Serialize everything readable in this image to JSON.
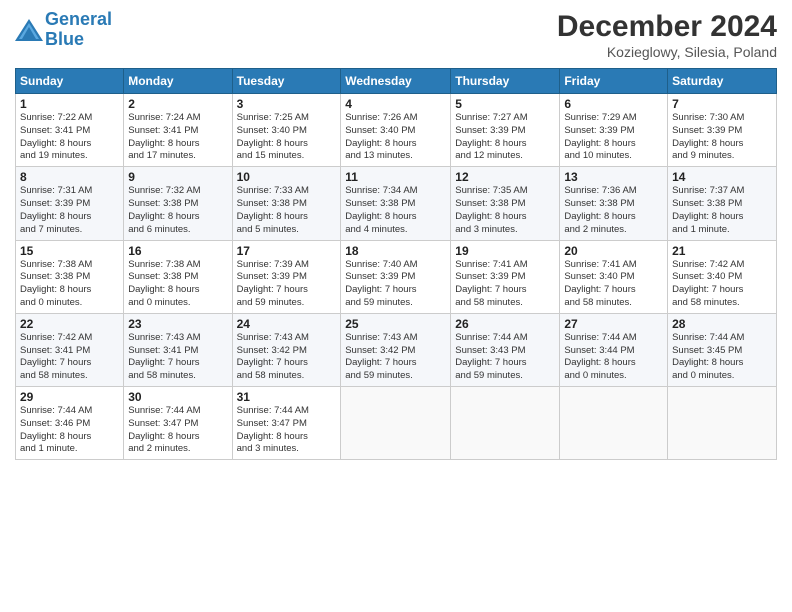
{
  "logo": {
    "line1": "General",
    "line2": "Blue"
  },
  "title": "December 2024",
  "subtitle": "Kozieglowy, Silesia, Poland",
  "days_header": [
    "Sunday",
    "Monday",
    "Tuesday",
    "Wednesday",
    "Thursday",
    "Friday",
    "Saturday"
  ],
  "weeks": [
    [
      {
        "day": "1",
        "info": "Sunrise: 7:22 AM\nSunset: 3:41 PM\nDaylight: 8 hours\nand 19 minutes."
      },
      {
        "day": "2",
        "info": "Sunrise: 7:24 AM\nSunset: 3:41 PM\nDaylight: 8 hours\nand 17 minutes."
      },
      {
        "day": "3",
        "info": "Sunrise: 7:25 AM\nSunset: 3:40 PM\nDaylight: 8 hours\nand 15 minutes."
      },
      {
        "day": "4",
        "info": "Sunrise: 7:26 AM\nSunset: 3:40 PM\nDaylight: 8 hours\nand 13 minutes."
      },
      {
        "day": "5",
        "info": "Sunrise: 7:27 AM\nSunset: 3:39 PM\nDaylight: 8 hours\nand 12 minutes."
      },
      {
        "day": "6",
        "info": "Sunrise: 7:29 AM\nSunset: 3:39 PM\nDaylight: 8 hours\nand 10 minutes."
      },
      {
        "day": "7",
        "info": "Sunrise: 7:30 AM\nSunset: 3:39 PM\nDaylight: 8 hours\nand 9 minutes."
      }
    ],
    [
      {
        "day": "8",
        "info": "Sunrise: 7:31 AM\nSunset: 3:39 PM\nDaylight: 8 hours\nand 7 minutes."
      },
      {
        "day": "9",
        "info": "Sunrise: 7:32 AM\nSunset: 3:38 PM\nDaylight: 8 hours\nand 6 minutes."
      },
      {
        "day": "10",
        "info": "Sunrise: 7:33 AM\nSunset: 3:38 PM\nDaylight: 8 hours\nand 5 minutes."
      },
      {
        "day": "11",
        "info": "Sunrise: 7:34 AM\nSunset: 3:38 PM\nDaylight: 8 hours\nand 4 minutes."
      },
      {
        "day": "12",
        "info": "Sunrise: 7:35 AM\nSunset: 3:38 PM\nDaylight: 8 hours\nand 3 minutes."
      },
      {
        "day": "13",
        "info": "Sunrise: 7:36 AM\nSunset: 3:38 PM\nDaylight: 8 hours\nand 2 minutes."
      },
      {
        "day": "14",
        "info": "Sunrise: 7:37 AM\nSunset: 3:38 PM\nDaylight: 8 hours\nand 1 minute."
      }
    ],
    [
      {
        "day": "15",
        "info": "Sunrise: 7:38 AM\nSunset: 3:38 PM\nDaylight: 8 hours\nand 0 minutes."
      },
      {
        "day": "16",
        "info": "Sunrise: 7:38 AM\nSunset: 3:38 PM\nDaylight: 8 hours\nand 0 minutes."
      },
      {
        "day": "17",
        "info": "Sunrise: 7:39 AM\nSunset: 3:39 PM\nDaylight: 7 hours\nand 59 minutes."
      },
      {
        "day": "18",
        "info": "Sunrise: 7:40 AM\nSunset: 3:39 PM\nDaylight: 7 hours\nand 59 minutes."
      },
      {
        "day": "19",
        "info": "Sunrise: 7:41 AM\nSunset: 3:39 PM\nDaylight: 7 hours\nand 58 minutes."
      },
      {
        "day": "20",
        "info": "Sunrise: 7:41 AM\nSunset: 3:40 PM\nDaylight: 7 hours\nand 58 minutes."
      },
      {
        "day": "21",
        "info": "Sunrise: 7:42 AM\nSunset: 3:40 PM\nDaylight: 7 hours\nand 58 minutes."
      }
    ],
    [
      {
        "day": "22",
        "info": "Sunrise: 7:42 AM\nSunset: 3:41 PM\nDaylight: 7 hours\nand 58 minutes."
      },
      {
        "day": "23",
        "info": "Sunrise: 7:43 AM\nSunset: 3:41 PM\nDaylight: 7 hours\nand 58 minutes."
      },
      {
        "day": "24",
        "info": "Sunrise: 7:43 AM\nSunset: 3:42 PM\nDaylight: 7 hours\nand 58 minutes."
      },
      {
        "day": "25",
        "info": "Sunrise: 7:43 AM\nSunset: 3:42 PM\nDaylight: 7 hours\nand 59 minutes."
      },
      {
        "day": "26",
        "info": "Sunrise: 7:44 AM\nSunset: 3:43 PM\nDaylight: 7 hours\nand 59 minutes."
      },
      {
        "day": "27",
        "info": "Sunrise: 7:44 AM\nSunset: 3:44 PM\nDaylight: 8 hours\nand 0 minutes."
      },
      {
        "day": "28",
        "info": "Sunrise: 7:44 AM\nSunset: 3:45 PM\nDaylight: 8 hours\nand 0 minutes."
      }
    ],
    [
      {
        "day": "29",
        "info": "Sunrise: 7:44 AM\nSunset: 3:46 PM\nDaylight: 8 hours\nand 1 minute."
      },
      {
        "day": "30",
        "info": "Sunrise: 7:44 AM\nSunset: 3:47 PM\nDaylight: 8 hours\nand 2 minutes."
      },
      {
        "day": "31",
        "info": "Sunrise: 7:44 AM\nSunset: 3:47 PM\nDaylight: 8 hours\nand 3 minutes."
      },
      null,
      null,
      null,
      null
    ]
  ]
}
